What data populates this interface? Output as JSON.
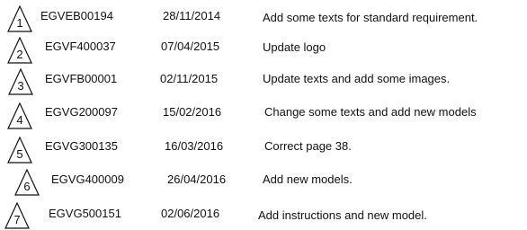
{
  "revisions": [
    {
      "number": "1",
      "code": "EGVEB00194",
      "date": "28/11/2014",
      "description": "Add some texts for standard requirement."
    },
    {
      "number": "2",
      "code": "EGVF400037",
      "date": "07/04/2015",
      "description": "Update logo"
    },
    {
      "number": "3",
      "code": "EGVFB00001",
      "date": "02/11/2015",
      "description": "Update texts and add some images."
    },
    {
      "number": "4",
      "code": "EGVG200097",
      "date": "15/02/2016",
      "description": "Change some texts and add new models"
    },
    {
      "number": "5",
      "code": "EGVG300135",
      "date": "16/03/2016",
      "description": "Correct page 38."
    },
    {
      "number": "6",
      "code": "EGVG400009",
      "date": "26/04/2016",
      "description": "Add new models."
    },
    {
      "number": "7",
      "code": "EGVG500151",
      "date": "02/06/2016",
      "description": "Add instructions and new model."
    }
  ]
}
